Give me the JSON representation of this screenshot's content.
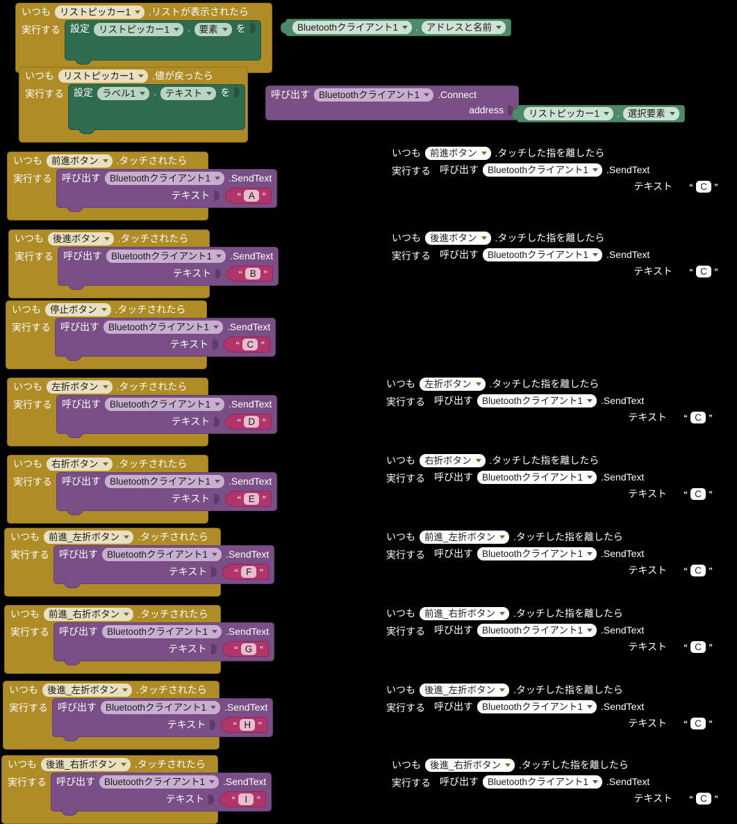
{
  "labels": {
    "when": "いつも",
    "do": "実行する",
    "set": "設定",
    "to": "を",
    "call": "呼び出す",
    "dot": ".",
    "quote_open": "“",
    "quote_close": "”"
  },
  "components": {
    "list_picker": "リストピッカー1",
    "bluetooth_client": "Bluetoothクライアント1",
    "label1": "ラベル1"
  },
  "events": {
    "before_picking": ".リストが表示されたら",
    "after_picking": ".値が戻ったら",
    "touch_down": ".タッチされたら",
    "touch_up": ".タッチした指を離したら"
  },
  "properties": {
    "elements": "要素",
    "text": "テキスト",
    "addresses_and_names": "アドレスと名前",
    "selection": "選択要素"
  },
  "methods": {
    "send_text": ".SendText",
    "connect": ".Connect",
    "address_param": "address",
    "text_param": "テキスト"
  },
  "colors": {
    "event_gold": "#b08c26",
    "call_purple": "#7a4f87",
    "string_crimson": "#b0356a",
    "setter_green": "#2f6b4f",
    "getter_green": "#4d8a69",
    "canvas_black": "#000000"
  },
  "blocks": {
    "listpicker_before": {
      "component": "リストピッカー1",
      "event": ".リストが表示されたら",
      "set_component": "リストピッカー1",
      "set_property": "要素",
      "get_component": "Bluetoothクライアント1",
      "get_property": "アドレスと名前"
    },
    "listpicker_after": {
      "component": "リストピッカー1",
      "event": ".値が戻ったら",
      "set_component": "ラベル1",
      "set_property": "テキスト",
      "call_component": "Bluetoothクライアント1",
      "call_method": ".Connect",
      "param_label": "address",
      "arg_component": "リストピッカー1",
      "arg_property": "選択要素"
    }
  },
  "touch_down_blocks": [
    {
      "button": "前進ボタン",
      "event": ".タッチされたら",
      "component": "Bluetoothクライアント1",
      "method": ".SendText",
      "param": "テキスト",
      "value": "A"
    },
    {
      "button": "後進ボタン",
      "event": ".タッチされたら",
      "component": "Bluetoothクライアント1",
      "method": ".SendText",
      "param": "テキスト",
      "value": "B"
    },
    {
      "button": "停止ボタン",
      "event": ".タッチされたら",
      "component": "Bluetoothクライアント1",
      "method": ".SendText",
      "param": "テキスト",
      "value": "C"
    },
    {
      "button": "左折ボタン",
      "event": ".タッチされたら",
      "component": "Bluetoothクライアント1",
      "method": ".SendText",
      "param": "テキスト",
      "value": "D"
    },
    {
      "button": "右折ボタン",
      "event": ".タッチされたら",
      "component": "Bluetoothクライアント1",
      "method": ".SendText",
      "param": "テキスト",
      "value": "E"
    },
    {
      "button": "前進_左折ボタン",
      "event": ".タッチされたら",
      "component": "Bluetoothクライアント1",
      "method": ".SendText",
      "param": "テキスト",
      "value": "F"
    },
    {
      "button": "前進_右折ボタン",
      "event": ".タッチされたら",
      "component": "Bluetoothクライアント1",
      "method": ".SendText",
      "param": "テキスト",
      "value": "G"
    },
    {
      "button": "後進_左折ボタン",
      "event": ".タッチされたら",
      "component": "Bluetoothクライアント1",
      "method": ".SendText",
      "param": "テキスト",
      "value": "H"
    },
    {
      "button": "後進_右折ボタン",
      "event": ".タッチされたら",
      "component": "Bluetoothクライアント1",
      "method": ".SendText",
      "param": "テキスト",
      "value": "I"
    }
  ],
  "touch_up_blocks": [
    {
      "button": "前進ボタン",
      "event": ".タッチした指を離したら",
      "component": "Bluetoothクライアント1",
      "method": ".SendText",
      "param": "テキスト",
      "value": "C"
    },
    {
      "button": "後進ボタン",
      "event": ".タッチした指を離したら",
      "component": "Bluetoothクライアント1",
      "method": ".SendText",
      "param": "テキスト",
      "value": "C"
    },
    {
      "button": "左折ボタン",
      "event": ".タッチした指を離したら",
      "component": "Bluetoothクライアント1",
      "method": ".SendText",
      "param": "テキスト",
      "value": "C"
    },
    {
      "button": "右折ボタン",
      "event": ".タッチした指を離したら",
      "component": "Bluetoothクライアント1",
      "method": ".SendText",
      "param": "テキスト",
      "value": "C"
    },
    {
      "button": "前進_左折ボタン",
      "event": ".タッチした指を離したら",
      "component": "Bluetoothクライアント1",
      "method": ".SendText",
      "param": "テキスト",
      "value": "C"
    },
    {
      "button": "前進_右折ボタン",
      "event": ".タッチした指を離したら",
      "component": "Bluetoothクライアント1",
      "method": ".SendText",
      "param": "テキスト",
      "value": "C"
    },
    {
      "button": "後進_左折ボタン",
      "event": ".タッチした指を離したら",
      "component": "Bluetoothクライアント1",
      "method": ".SendText",
      "param": "テキスト",
      "value": "C"
    },
    {
      "button": "後進_右折ボタン",
      "event": ".タッチした指を離したら",
      "component": "Bluetoothクライアント1",
      "method": ".SendText",
      "param": "テキスト",
      "value": "C"
    }
  ],
  "layout": {
    "left_column_tops": [
      218,
      330,
      432,
      543,
      654,
      759,
      870,
      979,
      1086
    ],
    "left_column_lefts": [
      10,
      12,
      8,
      10,
      10,
      6,
      6,
      4,
      2
    ],
    "right_column_tops": [
      208,
      330,
      540,
      650,
      760,
      870,
      980,
      1088
    ],
    "right_column_lefts": [
      556,
      556,
      548,
      548,
      548,
      548,
      548,
      556
    ]
  }
}
